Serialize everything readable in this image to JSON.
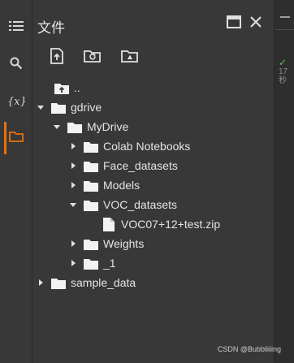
{
  "panel": {
    "title": "文件"
  },
  "tree": [
    {
      "label": "..",
      "kind": "up",
      "caret": "none"
    },
    {
      "label": "gdrive",
      "kind": "folder",
      "caret": "down"
    },
    {
      "label": "MyDrive",
      "kind": "folder",
      "caret": "down"
    },
    {
      "label": "Colab Notebooks",
      "kind": "folder",
      "caret": "right"
    },
    {
      "label": "Face_datasets",
      "kind": "folder",
      "caret": "right"
    },
    {
      "label": "Models",
      "kind": "folder",
      "caret": "right"
    },
    {
      "label": "VOC_datasets",
      "kind": "folder",
      "caret": "down"
    },
    {
      "label": "VOC07+12+test.zip",
      "kind": "file",
      "caret": "none"
    },
    {
      "label": "Weights",
      "kind": "folder",
      "caret": "right"
    },
    {
      "label": "_1",
      "kind": "folder",
      "caret": "right"
    },
    {
      "label": "sample_data",
      "kind": "folder",
      "caret": "right"
    }
  ],
  "exec": {
    "duration": "17",
    "unit": "秒"
  },
  "watermark": "CSDN @Bubbliiiing",
  "colors": {
    "accent": "#e8710a",
    "success": "#5ec25e"
  }
}
